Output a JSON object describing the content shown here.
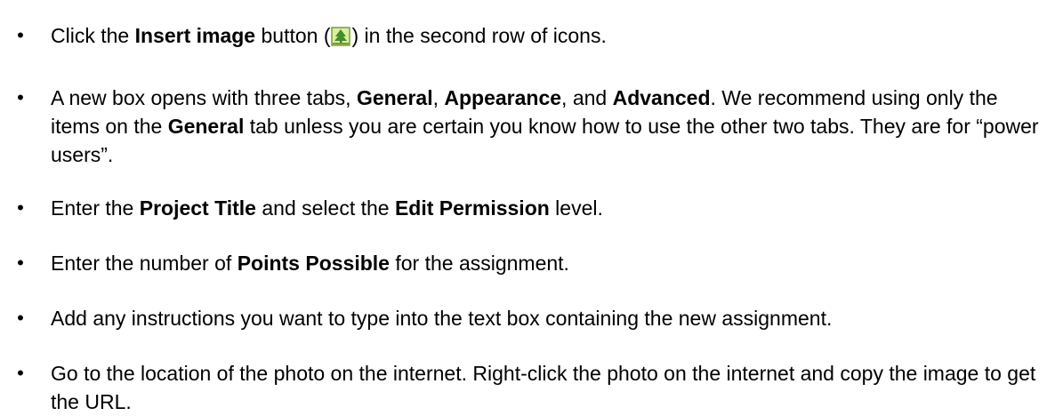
{
  "bullets": [
    {
      "id": "insert-image",
      "segments": [
        {
          "text": "Click the "
        },
        {
          "text": "Insert image",
          "bold": true
        },
        {
          "text": " button ("
        },
        {
          "icon": "insert-image-icon"
        },
        {
          "text": ") in the second row of icons."
        }
      ]
    },
    {
      "id": "tabs",
      "segments": [
        {
          "text": "A new box opens with three tabs, "
        },
        {
          "text": "General",
          "bold": true
        },
        {
          "text": ", "
        },
        {
          "text": "Appearance",
          "bold": true
        },
        {
          "text": ", and "
        },
        {
          "text": "Advanced",
          "bold": true
        },
        {
          "text": ". We recommend using only the items on the "
        },
        {
          "text": "General",
          "bold": true
        },
        {
          "text": " tab unless you are certain you know how to use the other two tabs. They are for “power users”."
        }
      ]
    },
    {
      "id": "project-title",
      "segments": [
        {
          "text": "Enter the "
        },
        {
          "text": "Project Title",
          "bold": true
        },
        {
          "text": " and select the "
        },
        {
          "text": "Edit Permission",
          "bold": true
        },
        {
          "text": " level."
        }
      ]
    },
    {
      "id": "points-possible",
      "segments": [
        {
          "text": "Enter the number of "
        },
        {
          "text": "Points Possible",
          "bold": true
        },
        {
          "text": " for the assignment."
        }
      ]
    },
    {
      "id": "instructions",
      "segments": [
        {
          "text": "Add any instructions you want to type into the text box containing the new assignment."
        }
      ]
    },
    {
      "id": "photo-url",
      "segments": [
        {
          "text": "Go to the location of the photo on the internet. Right-click the photo on the internet and copy the image to get the URL."
        }
      ]
    }
  ],
  "bullet_glyph": "•",
  "colors": {
    "icon_frame": "#7a9a3a",
    "icon_sky": "#d9ef9c",
    "icon_tree": "#3f8f2a",
    "icon_trunk": "#8a5a20"
  }
}
